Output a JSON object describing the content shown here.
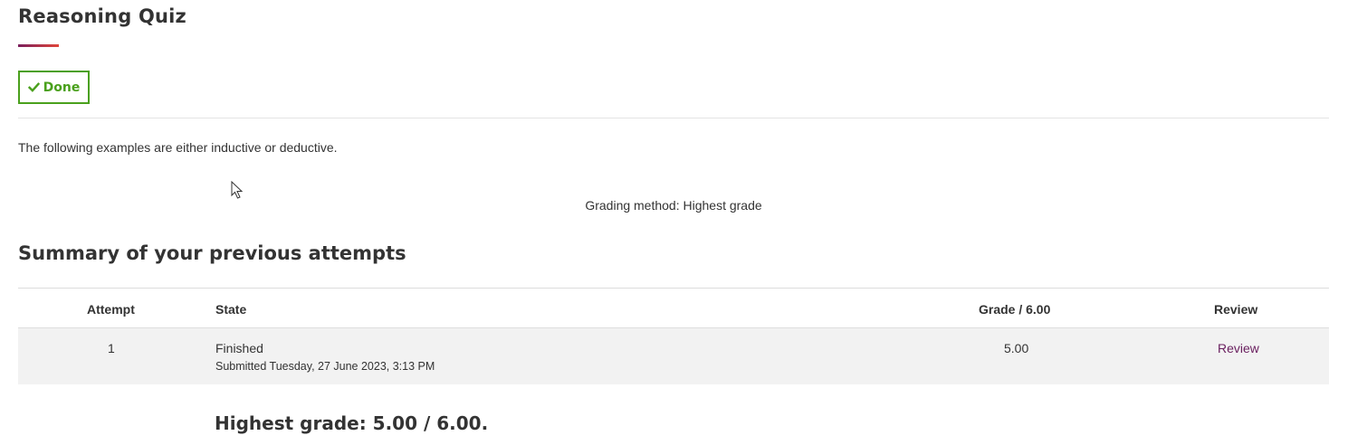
{
  "quiz": {
    "title": "Reasoning Quiz",
    "done_label": "Done",
    "intro": "The following examples are either inductive or deductive.",
    "grading_method": "Grading method: Highest grade"
  },
  "summary": {
    "heading": "Summary of your previous attempts",
    "columns": {
      "attempt": "Attempt",
      "state": "State",
      "grade": "Grade / 6.00",
      "review": "Review"
    },
    "rows": [
      {
        "attempt": "1",
        "state": "Finished",
        "submitted": "Submitted Tuesday, 27 June 2023, 3:13 PM",
        "grade": "5.00",
        "review": "Review"
      }
    ],
    "highest_grade": "Highest grade: 5.00 / 6.00."
  },
  "colors": {
    "done_green": "#4aa01c",
    "accent_from": "#7a1f5c",
    "accent_to": "#e0453a",
    "link": "#6b2160",
    "row_bg": "#f2f2f2"
  },
  "icons": {
    "done": "check-icon",
    "pointer": "mouse-cursor-icon"
  }
}
